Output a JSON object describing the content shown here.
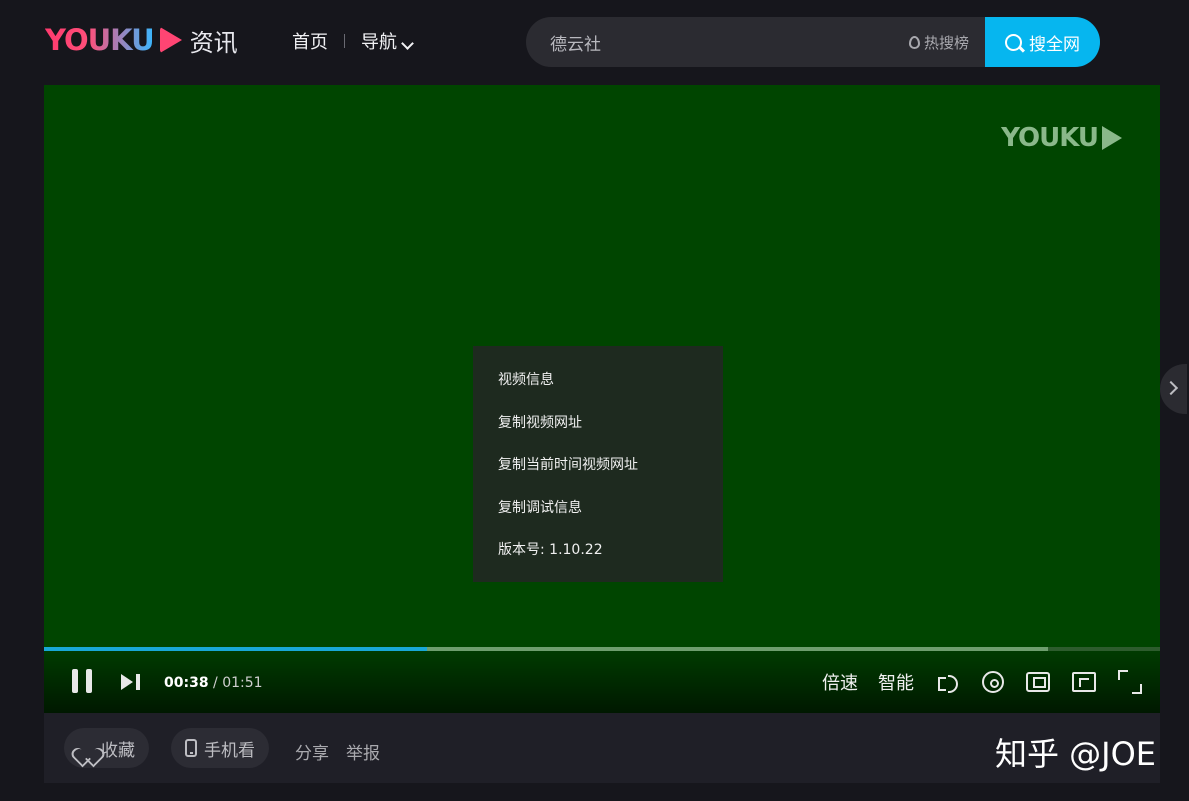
{
  "header": {
    "logo_text": "YOUKU",
    "logo_sub": "资讯",
    "nav": {
      "home": "首页",
      "guide": "导航"
    },
    "search": {
      "value": "德云社",
      "hot_label": "热搜榜",
      "button_label": "搜全网"
    }
  },
  "player": {
    "watermark": "YOUKU",
    "context_menu": [
      "视频信息",
      "复制视频网址",
      "复制当前时间视频网址",
      "复制调试信息",
      "版本号: 1.10.22"
    ],
    "progress": {
      "played_fraction": 0.343,
      "buffered_fraction": 0.9
    },
    "time": {
      "current": "00:38",
      "separator": " / ",
      "total": "01:51"
    },
    "controls": {
      "speed_label": "倍速",
      "quality_label": "智能"
    },
    "icons": [
      "pause-icon",
      "next-icon",
      "volume-icon",
      "settings-icon",
      "pip-icon",
      "widescreen-icon",
      "fullscreen-icon"
    ]
  },
  "actions": {
    "favorite_label": "收藏",
    "mobile_label": "手机看",
    "share_label": "分享",
    "report_label": "举报"
  },
  "watermark_overlay": "知乎 @JOE",
  "colors": {
    "accent": "#06b6ef",
    "video_bg": "#004500",
    "progress": "#19a8d6"
  }
}
